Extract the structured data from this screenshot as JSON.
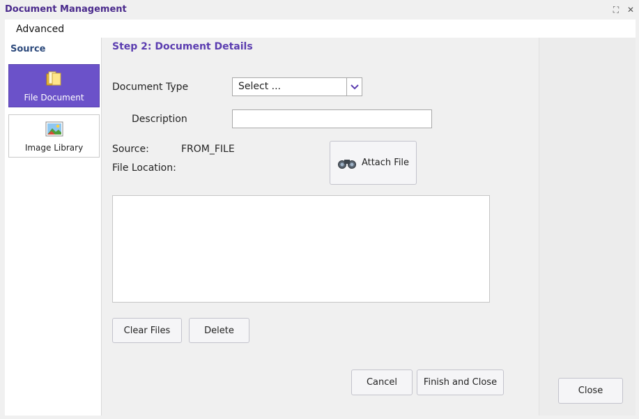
{
  "window": {
    "title": "Document Management",
    "maximize_glyph": "⛶",
    "close_glyph": "✕"
  },
  "tabs": [
    {
      "label": "Advanced"
    }
  ],
  "sidebar": {
    "title": "Source",
    "items": [
      {
        "label": "File Document",
        "icon": "folder-icon",
        "active": true
      },
      {
        "label": "Image Library",
        "icon": "image-icon",
        "active": false
      }
    ]
  },
  "main": {
    "step_title": "Step 2: Document Details",
    "document_type": {
      "label": "Document Type",
      "value": "Select ..."
    },
    "description": {
      "label": "Description",
      "value": ""
    },
    "source": {
      "label": "Source:",
      "value": "FROM_FILE"
    },
    "file_location": {
      "label": "File Location:",
      "value": ""
    },
    "attach_file_label": "Attach File",
    "clear_files_label": "Clear Files",
    "delete_label": "Delete",
    "cancel_label": "Cancel",
    "finish_label": "Finish and Close"
  },
  "right": {
    "close_label": "Close"
  },
  "colors": {
    "accent": "#6b52c9",
    "title": "#4a2a8c",
    "section": "#2d4a7c"
  }
}
